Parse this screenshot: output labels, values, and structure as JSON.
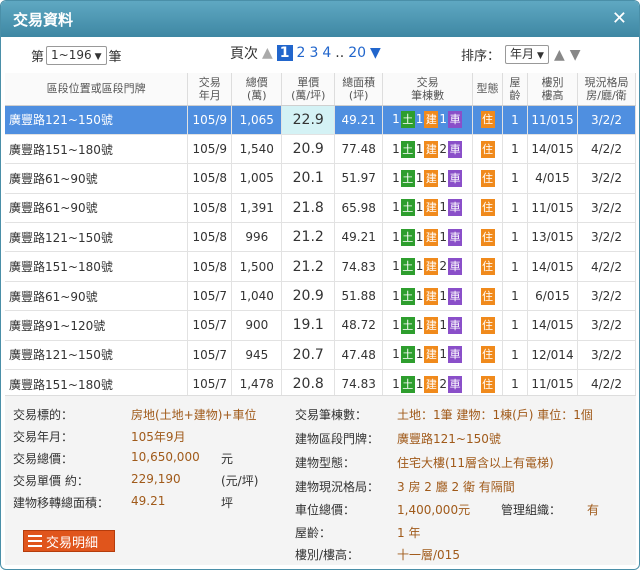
{
  "window": {
    "title": "交易資料",
    "close_icon": "✕"
  },
  "controls": {
    "page_prefix": "第",
    "page_select": "1~196",
    "page_suffix": "筆",
    "pager_label": "頁次",
    "pages": [
      "1",
      "2",
      "3",
      "4",
      "..",
      "20"
    ],
    "current_page": "1",
    "sort_label": "排序：",
    "sort_select": "年月"
  },
  "table": {
    "headers": [
      "區段位置或區段門牌",
      "交易\n年月",
      "總價\n(萬)",
      "單價\n(萬/坪)",
      "總面積\n(坪)",
      "交易\n筆棟數",
      "型態",
      "屋\n齡",
      "樓別\n樓高",
      "現況格局\n房/廳/衛"
    ],
    "badge_labels": {
      "land": "土",
      "building": "建",
      "car": "車",
      "residence": "住"
    },
    "rows": [
      {
        "addr": "廣豐路121~150號",
        "ym": "105/9",
        "total": "1,065",
        "unit": "22.9",
        "area": "49.21",
        "land": "1",
        "bld": "1",
        "car": "1",
        "age": "1",
        "floor": "11/015",
        "layout": "3/2/2"
      },
      {
        "addr": "廣豐路151~180號",
        "ym": "105/9",
        "total": "1,540",
        "unit": "20.9",
        "area": "77.48",
        "land": "1",
        "bld": "1",
        "car": "2",
        "age": "1",
        "floor": "14/015",
        "layout": "4/2/2"
      },
      {
        "addr": "廣豐路61~90號",
        "ym": "105/8",
        "total": "1,005",
        "unit": "20.1",
        "area": "51.97",
        "land": "1",
        "bld": "1",
        "car": "1",
        "age": "1",
        "floor": "4/015",
        "layout": "3/2/2"
      },
      {
        "addr": "廣豐路61~90號",
        "ym": "105/8",
        "total": "1,391",
        "unit": "21.8",
        "area": "65.98",
        "land": "1",
        "bld": "1",
        "car": "1",
        "age": "1",
        "floor": "11/015",
        "layout": "3/2/2"
      },
      {
        "addr": "廣豐路121~150號",
        "ym": "105/8",
        "total": "996",
        "unit": "21.2",
        "area": "49.21",
        "land": "1",
        "bld": "1",
        "car": "1",
        "age": "1",
        "floor": "13/015",
        "layout": "3/2/2"
      },
      {
        "addr": "廣豐路151~180號",
        "ym": "105/8",
        "total": "1,500",
        "unit": "21.2",
        "area": "74.83",
        "land": "1",
        "bld": "1",
        "car": "2",
        "age": "1",
        "floor": "14/015",
        "layout": "4/2/2"
      },
      {
        "addr": "廣豐路61~90號",
        "ym": "105/7",
        "total": "1,040",
        "unit": "20.9",
        "area": "51.88",
        "land": "1",
        "bld": "1",
        "car": "1",
        "age": "1",
        "floor": "6/015",
        "layout": "3/2/2"
      },
      {
        "addr": "廣豐路91~120號",
        "ym": "105/7",
        "total": "900",
        "unit": "19.1",
        "area": "48.72",
        "land": "1",
        "bld": "1",
        "car": "1",
        "age": "1",
        "floor": "14/015",
        "layout": "3/2/2"
      },
      {
        "addr": "廣豐路121~150號",
        "ym": "105/7",
        "total": "945",
        "unit": "20.7",
        "area": "47.48",
        "land": "1",
        "bld": "1",
        "car": "1",
        "age": "1",
        "floor": "12/014",
        "layout": "3/2/2"
      },
      {
        "addr": "廣豐路151~180號",
        "ym": "105/7",
        "total": "1,478",
        "unit": "20.8",
        "area": "74.83",
        "land": "1",
        "bld": "1",
        "car": "2",
        "age": "1",
        "floor": "11/015",
        "layout": "4/2/2"
      }
    ]
  },
  "detail": {
    "target_label": "交易標的：",
    "target_value": "房地(土地+建物)+車位",
    "ym_label": "交易年月：",
    "ym_value": "105年9月",
    "total_label": "交易總價：",
    "total_value": "10,650,000",
    "total_unit": "元",
    "unit_label": "交易單價 約：",
    "unit_value": "229,190",
    "unit_unit": "(元/坪)",
    "area_label": "建物移轉總面積：",
    "area_value": "49.21",
    "area_unit": "坪",
    "count_label": "交易筆棟數：",
    "count_value": "土地：1筆 建物：1棟(戶) 車位：1個",
    "addr_label": "建物區段門牌：",
    "addr_value": "廣豐路121~150號",
    "type_label": "建物型態：",
    "type_value": "住宅大樓(11層含以上有電梯)",
    "layout_label": "建物現況格局：",
    "layout_value": "3 房 2 廳 2 衛 有隔間",
    "car_label": "車位總價：",
    "car_value": "1,400,000元",
    "mgmt_label": "管理組織：",
    "mgmt_value": "有",
    "age_label": "屋齡：",
    "age_value": "1 年",
    "floor_label": "樓別/樓高：",
    "floor_value": "十一層/015",
    "button_label": "交易明細"
  }
}
